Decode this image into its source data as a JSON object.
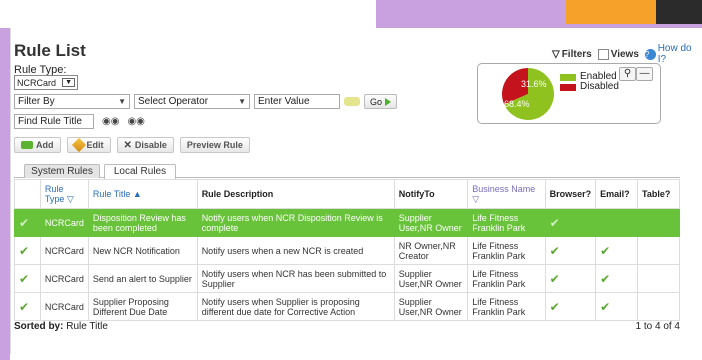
{
  "page": {
    "title": "Rule List",
    "top_actions": {
      "filters": "Filters",
      "views": "Views",
      "help": "How do I?"
    }
  },
  "filters": {
    "rule_type_label": "Rule Type:",
    "rule_type_value": "NCRCard",
    "filter_by": "Filter By",
    "select_operator": "Select Operator",
    "enter_value": "Enter Value",
    "go_label": "Go",
    "find_rule_title": "Find Rule Title"
  },
  "toolbar": {
    "add": "Add",
    "edit": "Edit",
    "disable": "Disable",
    "preview": "Preview Rule"
  },
  "chart_data": {
    "type": "pie",
    "categories": [
      "Enabled",
      "Disabled"
    ],
    "values": [
      68.4,
      31.6
    ],
    "labels": [
      "68.4%",
      "31.6%"
    ],
    "colors": [
      "#8fc21f",
      "#c4131c"
    ],
    "legend_position": "right"
  },
  "tabs": [
    {
      "label": "System Rules",
      "active": false
    },
    {
      "label": "Local Rules",
      "active": true
    }
  ],
  "table": {
    "headers": [
      "Rule Type ▽",
      "Rule Title ▲",
      "Rule Description",
      "NotifyTo",
      "Business Name ▽",
      "Browser?",
      "Email?",
      "Table?"
    ],
    "rows": [
      [
        "NCRCard",
        "Disposition Review has been completed",
        "Notify users when NCR Disposition Review is complete",
        "Supplier User,NR Owner",
        "Life Fitness Franklin Park",
        "✔",
        "",
        ""
      ],
      [
        "NCRCard",
        "New NCR Notification",
        "Notify users when a new NCR is created",
        "NR Owner,NR Creator",
        "Life Fitness Franklin Park",
        "✔",
        "✔",
        ""
      ],
      [
        "NCRCard",
        "Send an alert to Supplier",
        "Notify users when NCR has been submitted to Supplier",
        "Supplier User,NR Owner",
        "Life Fitness Franklin Park",
        "✔",
        "✔",
        ""
      ],
      [
        "NCRCard",
        "Supplier Proposing Different Due Date",
        "Notify users when Supplier is proposing different due date for Corrective Action",
        "Supplier User,NR Owner",
        "Life Fitness Franklin Park",
        "✔",
        "✔",
        ""
      ]
    ]
  },
  "footer": {
    "sorted_by_label": "Sorted by:",
    "sorted_by_value": "Rule Title",
    "range": "1 to 4 of 4"
  }
}
